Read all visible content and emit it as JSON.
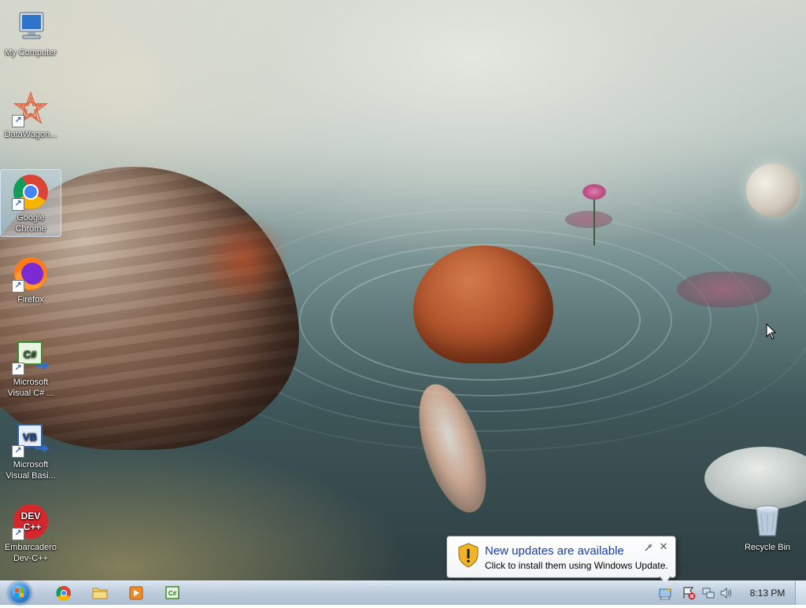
{
  "desktop": {
    "icons": [
      {
        "label": "My Computer",
        "icon": "computer-icon"
      },
      {
        "label": "DataWagon...",
        "icon": "datawagon-icon"
      },
      {
        "label": "Google Chrome",
        "icon": "chrome-icon"
      },
      {
        "label": "Firefox",
        "icon": "firefox-icon"
      },
      {
        "label": "Microsoft Visual C# ...",
        "icon": "visual-csharp-icon"
      },
      {
        "label": "Microsoft Visual Basi...",
        "icon": "visual-basic-icon"
      },
      {
        "label": "Embarcadero Dev-C++",
        "icon": "devcpp-icon"
      },
      {
        "label": "Recycle Bin",
        "icon": "recycle-bin-icon"
      }
    ],
    "icon_text": {
      "csharp": "C#",
      "vb": "VB",
      "dev": "DEV",
      "cpp": "C++"
    }
  },
  "notification": {
    "title": "New updates are available",
    "text": "Click to install them using Windows Update.",
    "icon": "security-shield-icon"
  },
  "taskbar": {
    "start_icon": "windows-start-icon",
    "pinned": [
      {
        "name": "chrome",
        "icon": "chrome-icon"
      },
      {
        "name": "explorer",
        "icon": "folder-icon"
      },
      {
        "name": "media-player",
        "icon": "media-player-icon"
      },
      {
        "name": "visual-csharp",
        "icon": "visual-csharp-icon"
      }
    ],
    "tray_icons": [
      "windows-update-icon",
      "action-center-icon",
      "network-icon",
      "volume-icon"
    ],
    "clock": "8:13 PM"
  }
}
